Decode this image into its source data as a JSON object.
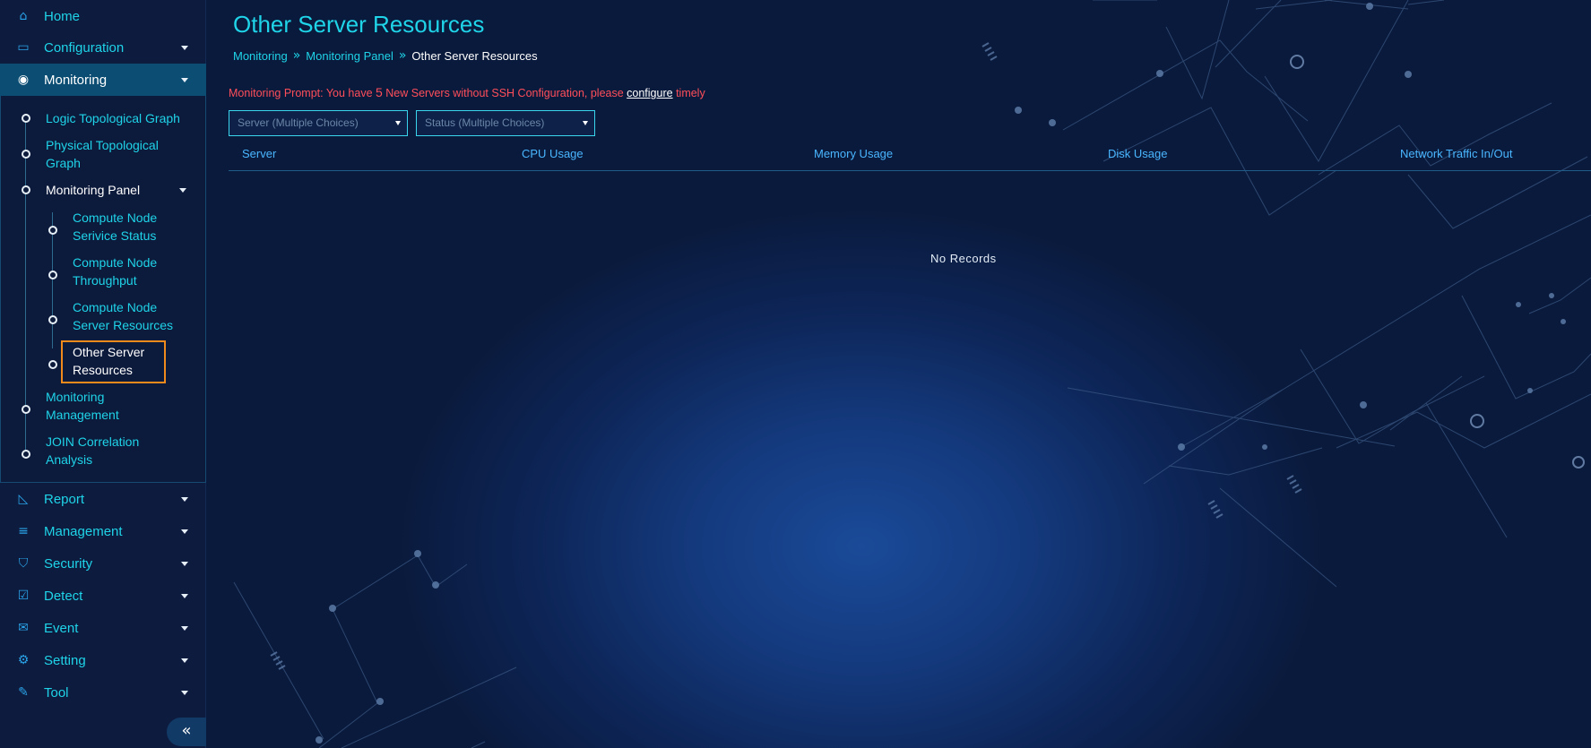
{
  "sidebar": {
    "items": [
      {
        "label": "Home",
        "icon": "home-icon"
      },
      {
        "label": "Configuration",
        "icon": "monitor-icon"
      },
      {
        "label": "Monitoring",
        "icon": "eye-icon"
      },
      {
        "label": "Report",
        "icon": "area-chart-icon"
      },
      {
        "label": "Management",
        "icon": "database-icon"
      },
      {
        "label": "Security",
        "icon": "shield-icon"
      },
      {
        "label": "Detect",
        "icon": "check-square-icon"
      },
      {
        "label": "Event",
        "icon": "envelope-icon"
      },
      {
        "label": "Setting",
        "icon": "gear-icon"
      },
      {
        "label": "Tool",
        "icon": "wrench-icon"
      }
    ],
    "monitoring_sub": {
      "logic": "Logic Topological Graph",
      "physical_1": "Physical Topological",
      "physical_2": "Graph",
      "panel": "Monitoring Panel",
      "panel_items": {
        "service_1": "Compute Node",
        "service_2": "Serivice Status",
        "throughput_1": "Compute Node",
        "throughput_2": "Throughput",
        "resources_1": "Compute Node",
        "resources_2": "Server Resources",
        "other_1": "Other Server",
        "other_2": "Resources"
      },
      "management_1": "Monitoring",
      "management_2": "Management",
      "join_1": "JOIN Correlation",
      "join_2": "Analysis"
    },
    "collapse_icon": "double-chevron-left-icon"
  },
  "page": {
    "title": "Other Server Resources",
    "breadcrumb": [
      "Monitoring",
      "Monitoring Panel",
      "Other Server Resources"
    ],
    "prompt": {
      "prefix": "Monitoring Prompt: You have ",
      "count": "5",
      "middle": " New Servers without SSH Configuration, please ",
      "link": "configure",
      "suffix": " timely"
    },
    "filters": {
      "server": "Server (Multiple Choices)",
      "status": "Status (Multiple Choices)"
    },
    "table": {
      "columns": [
        "Server",
        "CPU Usage",
        "Memory Usage",
        "Disk Usage",
        "Network Traffic In/Out"
      ],
      "empty": "No Records"
    }
  },
  "colors": {
    "accent": "#1fd4e8",
    "active_bg": "#0b4d73",
    "prompt": "#ff4e5a",
    "selection_border": "#f08a1c",
    "header_text": "#49b6ff"
  }
}
